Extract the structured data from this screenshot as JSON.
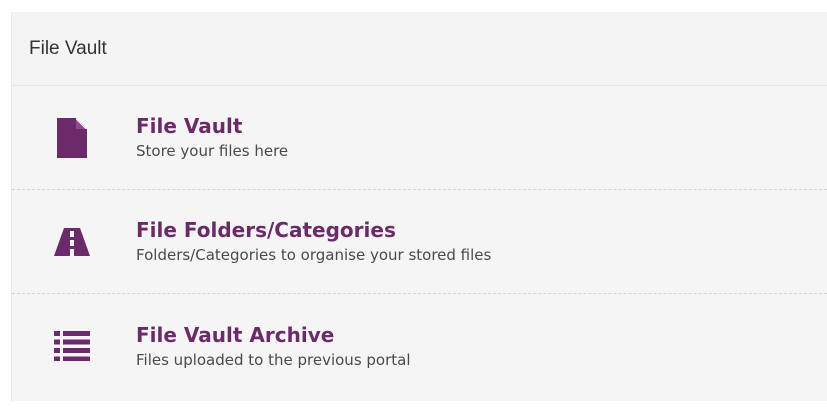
{
  "header": {
    "title": "File Vault"
  },
  "colors": {
    "accent": "#6b2a6a",
    "panel_background": "#f5f5f5"
  },
  "items": [
    {
      "title": "File Vault",
      "description": "Store your files here",
      "icon": "file-icon"
    },
    {
      "title": "File Folders/Categories",
      "description": "Folders/Categories to organise your stored files",
      "icon": "road-sign-icon"
    },
    {
      "title": "File Vault Archive",
      "description": "Files uploaded to the previous portal",
      "icon": "list-icon"
    }
  ]
}
